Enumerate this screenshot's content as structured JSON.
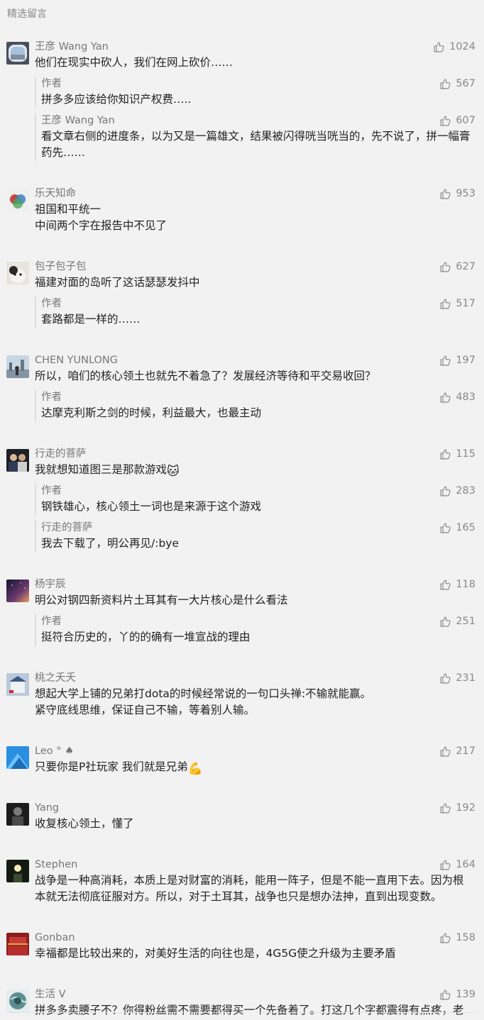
{
  "section_title": "精选留言",
  "colors": {
    "background": "#f2f2f2",
    "nick": "#777777",
    "text": "#222222",
    "reply_bar": "#dcdcdc"
  },
  "comments": [
    {
      "nick": "王彦 Wang Yan",
      "likes": "1024",
      "avatar": "window",
      "gap": 0,
      "text": "他们在现实中砍人，我们在网上砍价……",
      "replies": [
        {
          "nick": "作者",
          "likes": "567",
          "text": "拼多多应该给你知识产权费….."
        },
        {
          "nick": "王彦 Wang Yan",
          "likes": "607",
          "text": "看文章右侧的进度条，以为又是一篇雄文，结果被闪得咣当咣当的，先不说了，拼一幅膏药先……"
        }
      ]
    },
    {
      "nick": "乐天知命",
      "likes": "953",
      "avatar": "circles",
      "gap": 36,
      "text": "祖国和平统一\n中间两个字在报告中不见了",
      "replies": []
    },
    {
      "nick": "包子包子包",
      "likes": "627",
      "avatar": "cat",
      "gap": 36,
      "text": "福建对面的岛听了这话瑟瑟发抖中",
      "replies": [
        {
          "nick": "作者",
          "likes": "517",
          "text": "套路都是一样的……"
        }
      ]
    },
    {
      "nick": "CHEN YUNLONG",
      "likes": "197",
      "avatar": "city",
      "gap": 36,
      "text": "所以，咱们的核心领土也就先不着急了？发展经济等待和平交易收回？",
      "replies": [
        {
          "nick": "作者",
          "likes": "483",
          "text": "达摩克利斯之剑的时候，利益最大，也最主动"
        }
      ]
    },
    {
      "nick": "行走的菩萨",
      "likes": "115",
      "avatar": "people",
      "gap": 36,
      "text": "我就想知道图三是那款游戏",
      "emoji": "🐱",
      "replies": [
        {
          "nick": "作者",
          "likes": "283",
          "text": "钢铁雄心，核心领土一词也是来源于这个游戏"
        },
        {
          "nick": "行走的菩萨",
          "likes": "165",
          "text": "我去下载了，明公再见/:bye"
        }
      ]
    },
    {
      "nick": "杨宇辰",
      "likes": "118",
      "avatar": "space",
      "gap": 36,
      "text": "明公对钢四新资料片土耳其有一大片核心是什么看法",
      "replies": [
        {
          "nick": "作者",
          "likes": "251",
          "text": "挺符合历史的，丫的的确有一堆宣战的理由"
        }
      ]
    },
    {
      "nick": "桃之夭夭",
      "likes": "231",
      "avatar": "building",
      "gap": 36,
      "text": "想起大学上铺的兄弟打dota的时候经常说的一句口头禅:不输就能赢。\n紧守底线思维，保证自己不输，等着别人输。",
      "replies": []
    },
    {
      "nick": "Leo ° ♠",
      "likes": "217",
      "avatar": "blue",
      "gap": 36,
      "text": "只要你是P社玩家 我们就是兄弟",
      "emoji": "💪",
      "replies": []
    },
    {
      "nick": "Yang",
      "likes": "192",
      "avatar": "dark",
      "gap": 36,
      "text": "收复核心领土，懂了",
      "replies": []
    },
    {
      "nick": "Stephen",
      "likes": "164",
      "avatar": "light",
      "gap": 36,
      "text": "战争是一种高消耗，本质上是对财富的消耗，能用一阵子，但是不能一直用下去。因为根本就无法彻底征服对方。所以，对于土耳其，战争也只是想办法抻，直到出现变数。",
      "replies": []
    },
    {
      "nick": "Gonban",
      "likes": "158",
      "avatar": "red",
      "gap": 36,
      "text": "幸福都是比较出来的，对美好生活的向往也是，4G5G使之升级为主要矛盾",
      "replies": []
    },
    {
      "nick": "生活 V",
      "likes": "139",
      "avatar": "globe",
      "gap": 36,
      "text": "拼多多卖腰子不？你得粉丝需不需要都得买一个先备着了。打这几个字都震得有点疼，老伤了。",
      "replies": []
    }
  ]
}
